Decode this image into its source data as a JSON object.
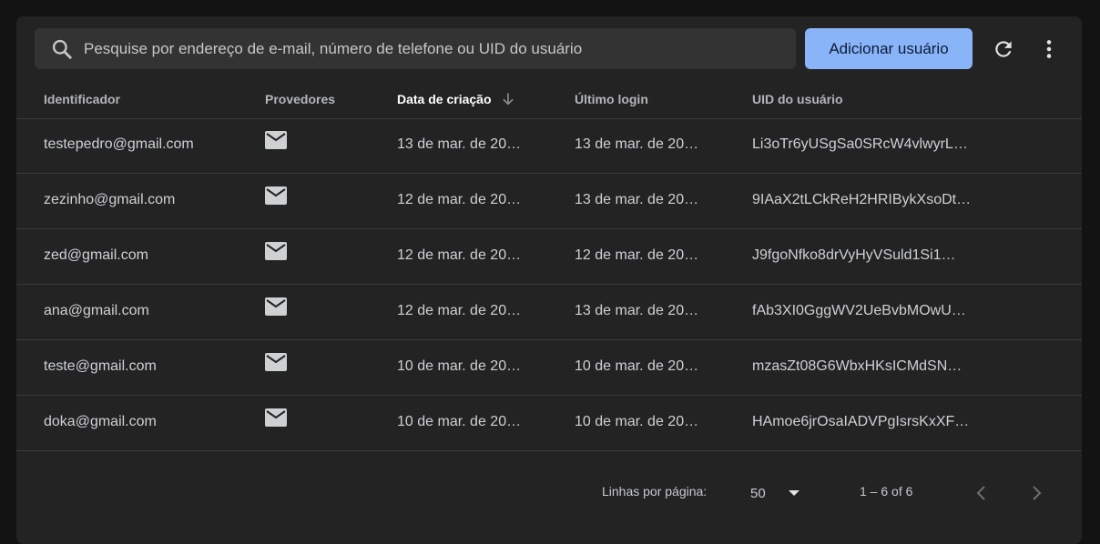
{
  "search": {
    "placeholder": "Pesquise por endereço de e-mail, número de telefone ou UID do usuário"
  },
  "toolbar": {
    "add_user_label": "Adicionar usuário"
  },
  "table": {
    "headers": [
      "Identificador",
      "Provedores",
      "Data de criação",
      "Último login",
      "UID do usuário"
    ],
    "rows": [
      {
        "identifier": "testepedro@gmail.com",
        "provider_icon": "mail-icon",
        "created": "13 de mar. de 20…",
        "last_login": "13 de mar. de 20…",
        "uid": "Li3oTr6yUSgSa0SRcW4vlwyrL…"
      },
      {
        "identifier": "zezinho@gmail.com",
        "provider_icon": "mail-icon",
        "created": "12 de mar. de 20…",
        "last_login": "13 de mar. de 20…",
        "uid": "9IAaX2tLCkReH2HRIBykXsoDt…"
      },
      {
        "identifier": "zed@gmail.com",
        "provider_icon": "mail-icon",
        "created": "12 de mar. de 20…",
        "last_login": "12 de mar. de 20…",
        "uid": "J9fgoNfko8drVyHyVSuld1Si1…"
      },
      {
        "identifier": "ana@gmail.com",
        "provider_icon": "mail-icon",
        "created": "12 de mar. de 20…",
        "last_login": "13 de mar. de 20…",
        "uid": "fAb3XI0GggWV2UeBvbMOwU…"
      },
      {
        "identifier": "teste@gmail.com",
        "provider_icon": "mail-icon",
        "created": "10 de mar. de 20…",
        "last_login": "10 de mar. de 20…",
        "uid": "mzasZt08G6WbxHKsICMdSN…"
      },
      {
        "identifier": "doka@gmail.com",
        "provider_icon": "mail-icon",
        "created": "10 de mar. de 20…",
        "last_login": "10 de mar. de 20…",
        "uid": "HAmoe6jrOsaIADVPgIsrsKxXF…"
      }
    ]
  },
  "footer": {
    "rows_per_page_label": "Linhas por página:",
    "rows_per_page_value": "50",
    "range": "1 – 6 of 6"
  },
  "colors": {
    "accent": "#8ab4f8",
    "background": "#131313",
    "surface": "#232324"
  }
}
